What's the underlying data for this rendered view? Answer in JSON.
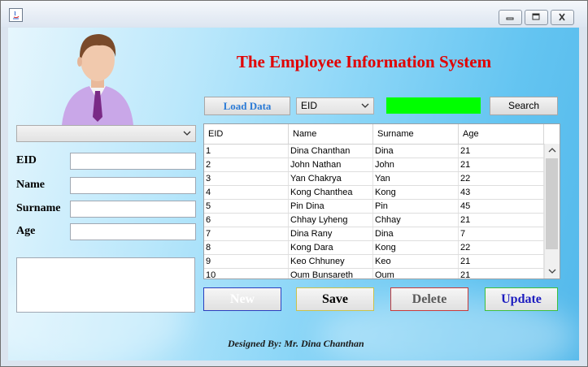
{
  "window": {
    "title": "",
    "controls": {
      "minimize": "minimize-icon",
      "maximize": "maximize-icon",
      "close": "close-icon"
    }
  },
  "header": {
    "title": "The Employee Information System"
  },
  "left_panel": {
    "selector_value": "",
    "fields": [
      {
        "label": "EID",
        "value": ""
      },
      {
        "label": "Name",
        "value": ""
      },
      {
        "label": "Surname",
        "value": ""
      },
      {
        "label": "Age",
        "value": ""
      }
    ],
    "notes_value": ""
  },
  "toolbar": {
    "load_label": "Load Data",
    "search_field_selected": "EID",
    "search_value": "",
    "search_label": "Search"
  },
  "table": {
    "columns": [
      "EID",
      "Name",
      "Surname",
      "Age"
    ],
    "rows": [
      [
        "1",
        "Dina Chanthan",
        "Dina",
        "21"
      ],
      [
        "2",
        "John Nathan",
        "John",
        "21"
      ],
      [
        "3",
        "Yan Chakrya",
        "Yan",
        "22"
      ],
      [
        "4",
        "Kong Chanthea",
        "Kong",
        "43"
      ],
      [
        "5",
        "Pin Dina",
        "Pin",
        "45"
      ],
      [
        "6",
        "Chhay Lyheng",
        "Chhay",
        "21"
      ],
      [
        "7",
        "Dina Rany",
        "Dina",
        "7"
      ],
      [
        "8",
        "Kong Dara",
        "Kong",
        "22"
      ],
      [
        "9",
        "Keo Chhuney",
        "Keo",
        "21"
      ],
      [
        "10",
        "Oum Bunsareth",
        "Oum",
        "21"
      ]
    ]
  },
  "actions": {
    "new_label": "New",
    "save_label": "Save",
    "delete_label": "Delete",
    "update_label": "Update"
  },
  "footer": {
    "credit": "Designed By: Mr. Dina Chanthan"
  },
  "colors": {
    "title": "#e10000",
    "search_indicator": "#00ff00",
    "load_text": "#2b7bd6",
    "update_text": "#1c1cbf"
  }
}
